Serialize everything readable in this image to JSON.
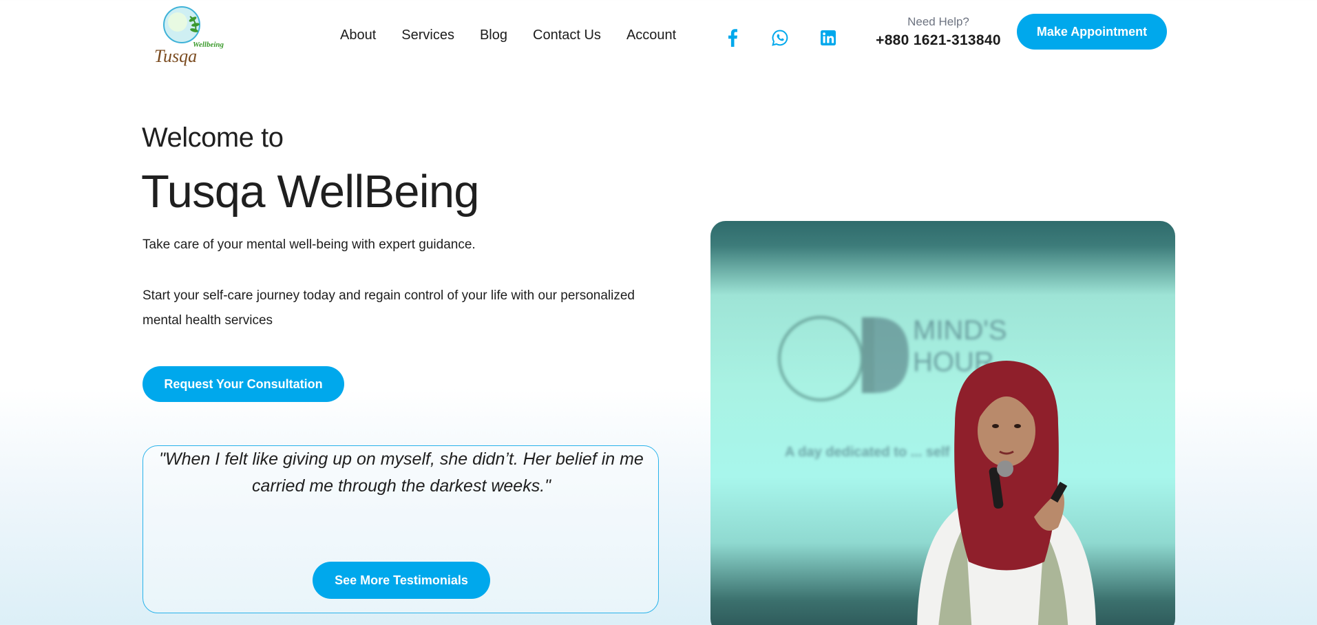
{
  "header": {
    "logo_text": "Tusqa",
    "logo_sub": "Wellbeing",
    "nav": [
      "About",
      "Services",
      "Blog",
      "Contact Us",
      "Account"
    ],
    "social_icons": [
      "facebook-icon",
      "whatsapp-icon",
      "linkedin-icon"
    ],
    "help_label": "Need Help?",
    "phone": "+880 1621-313840",
    "cta": "Make Appointment"
  },
  "hero": {
    "welcome": "Welcome to",
    "brand": "Tusqa WellBeing",
    "tagline": "Take care of your mental well-being with expert guidance.",
    "description": "Start your self-care journey today and regain control of your life with our personalized mental health services",
    "cta": "Request Your Consultation"
  },
  "testimonial": {
    "quote": "\"When I felt like giving up on myself, she didn’t. Her belief in me carried me through the darkest weeks.\"",
    "cta": "See More Testimonials"
  },
  "photo": {
    "screen_text_1": "MIND'S",
    "screen_text_2": "HOUR",
    "screen_text_3": "A day dedicated to ... self"
  },
  "colors": {
    "accent": "#00a8ec",
    "text": "#1c1c1c"
  }
}
